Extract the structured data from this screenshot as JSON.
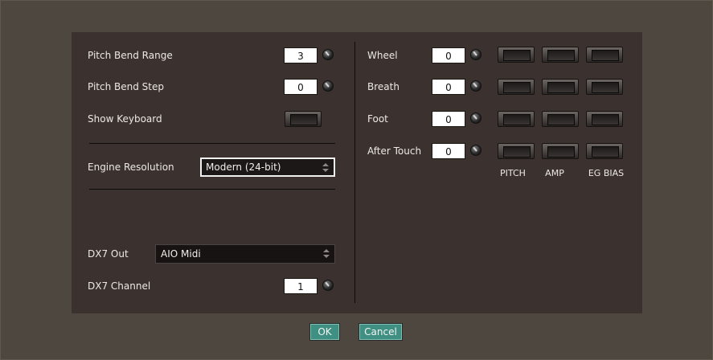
{
  "left": {
    "pitch_bend_range": {
      "label": "Pitch Bend Range",
      "value": "3"
    },
    "pitch_bend_step": {
      "label": "Pitch Bend Step",
      "value": "0"
    },
    "show_keyboard": {
      "label": "Show Keyboard"
    },
    "engine_resolution": {
      "label": "Engine Resolution",
      "value": "Modern (24-bit)"
    },
    "dx7_out": {
      "label": "DX7 Out",
      "value": "AIO Midi"
    },
    "dx7_channel": {
      "label": "DX7 Channel",
      "value": "1"
    }
  },
  "right": {
    "rows": [
      {
        "label": "Wheel",
        "value": "0"
      },
      {
        "label": "Breath",
        "value": "0"
      },
      {
        "label": "Foot",
        "value": "0"
      },
      {
        "label": "After Touch",
        "value": "0"
      }
    ],
    "columns": [
      "PITCH",
      "AMP",
      "EG BIAS"
    ]
  },
  "buttons": {
    "ok": "OK",
    "cancel": "Cancel"
  },
  "colors": {
    "panel": "#3b322f",
    "background": "#4d473f",
    "button": "#3f8f82"
  }
}
